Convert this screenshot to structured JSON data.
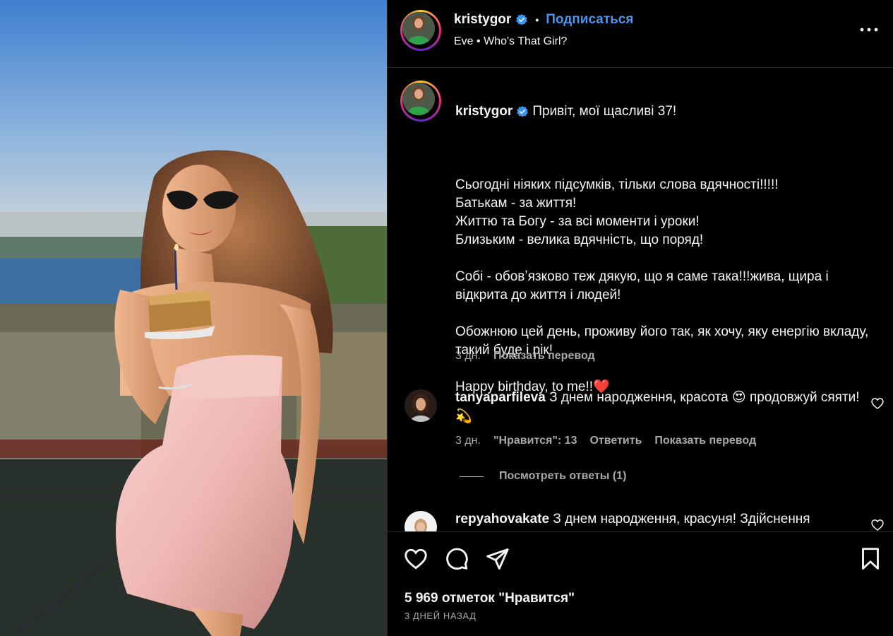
{
  "post": {
    "username": "kristygor",
    "follow_label": "Подписаться",
    "audio_artist": "Eve",
    "audio_title": "Who's That Girl?"
  },
  "caption": {
    "username": "kristygor",
    "first_line": "Привіт, мої щасливі 37!",
    "body": "Сьогодні ніяких підсумків, тільки слова вдячності!!!!!\nБатькам - за життя!\nЖиттю та Богу - за всі моменти і уроки!\nБлизьким - велика вдячність, що поряд!\n\nСобі - обовʼязково теж дякую, що я саме така!!!жива, щира і відкрита до життя і людей!\n\nОбожнюю цей день, проживу його так, як хочу, яку енергію вкладу, такий буде і рік!\n\nHappy birthday, to me!!❤️",
    "time": "3 дн.",
    "translate": "Показать перевод"
  },
  "comments": [
    {
      "username": "tanyaparfileva",
      "text": "З днем народження, красота 😍 продовжуй сяяти! 💫",
      "time": "3 дн.",
      "likes": "\"Нравится\": 13",
      "reply": "Ответить",
      "translate": "Показать перевод",
      "view_replies": "Посмотреть ответы (1)"
    },
    {
      "username": "repyahovakate",
      "text": "З днем народження, красуня! Здійснення"
    }
  ],
  "footer": {
    "likes": "5 969 отметок \"Нравится\"",
    "posted": "3 ДНЕЙ НАЗАД"
  },
  "icons": {
    "like": "heart-icon",
    "comment": "comment-icon",
    "share": "share-icon",
    "save": "bookmark-icon",
    "more": "more-dots-icon",
    "verified": "verified-badge-icon"
  },
  "colors": {
    "background": "#000000",
    "link_blue": "#4a95f0",
    "verified_blue": "#3897f0",
    "muted_text": "#a8a8a8"
  }
}
